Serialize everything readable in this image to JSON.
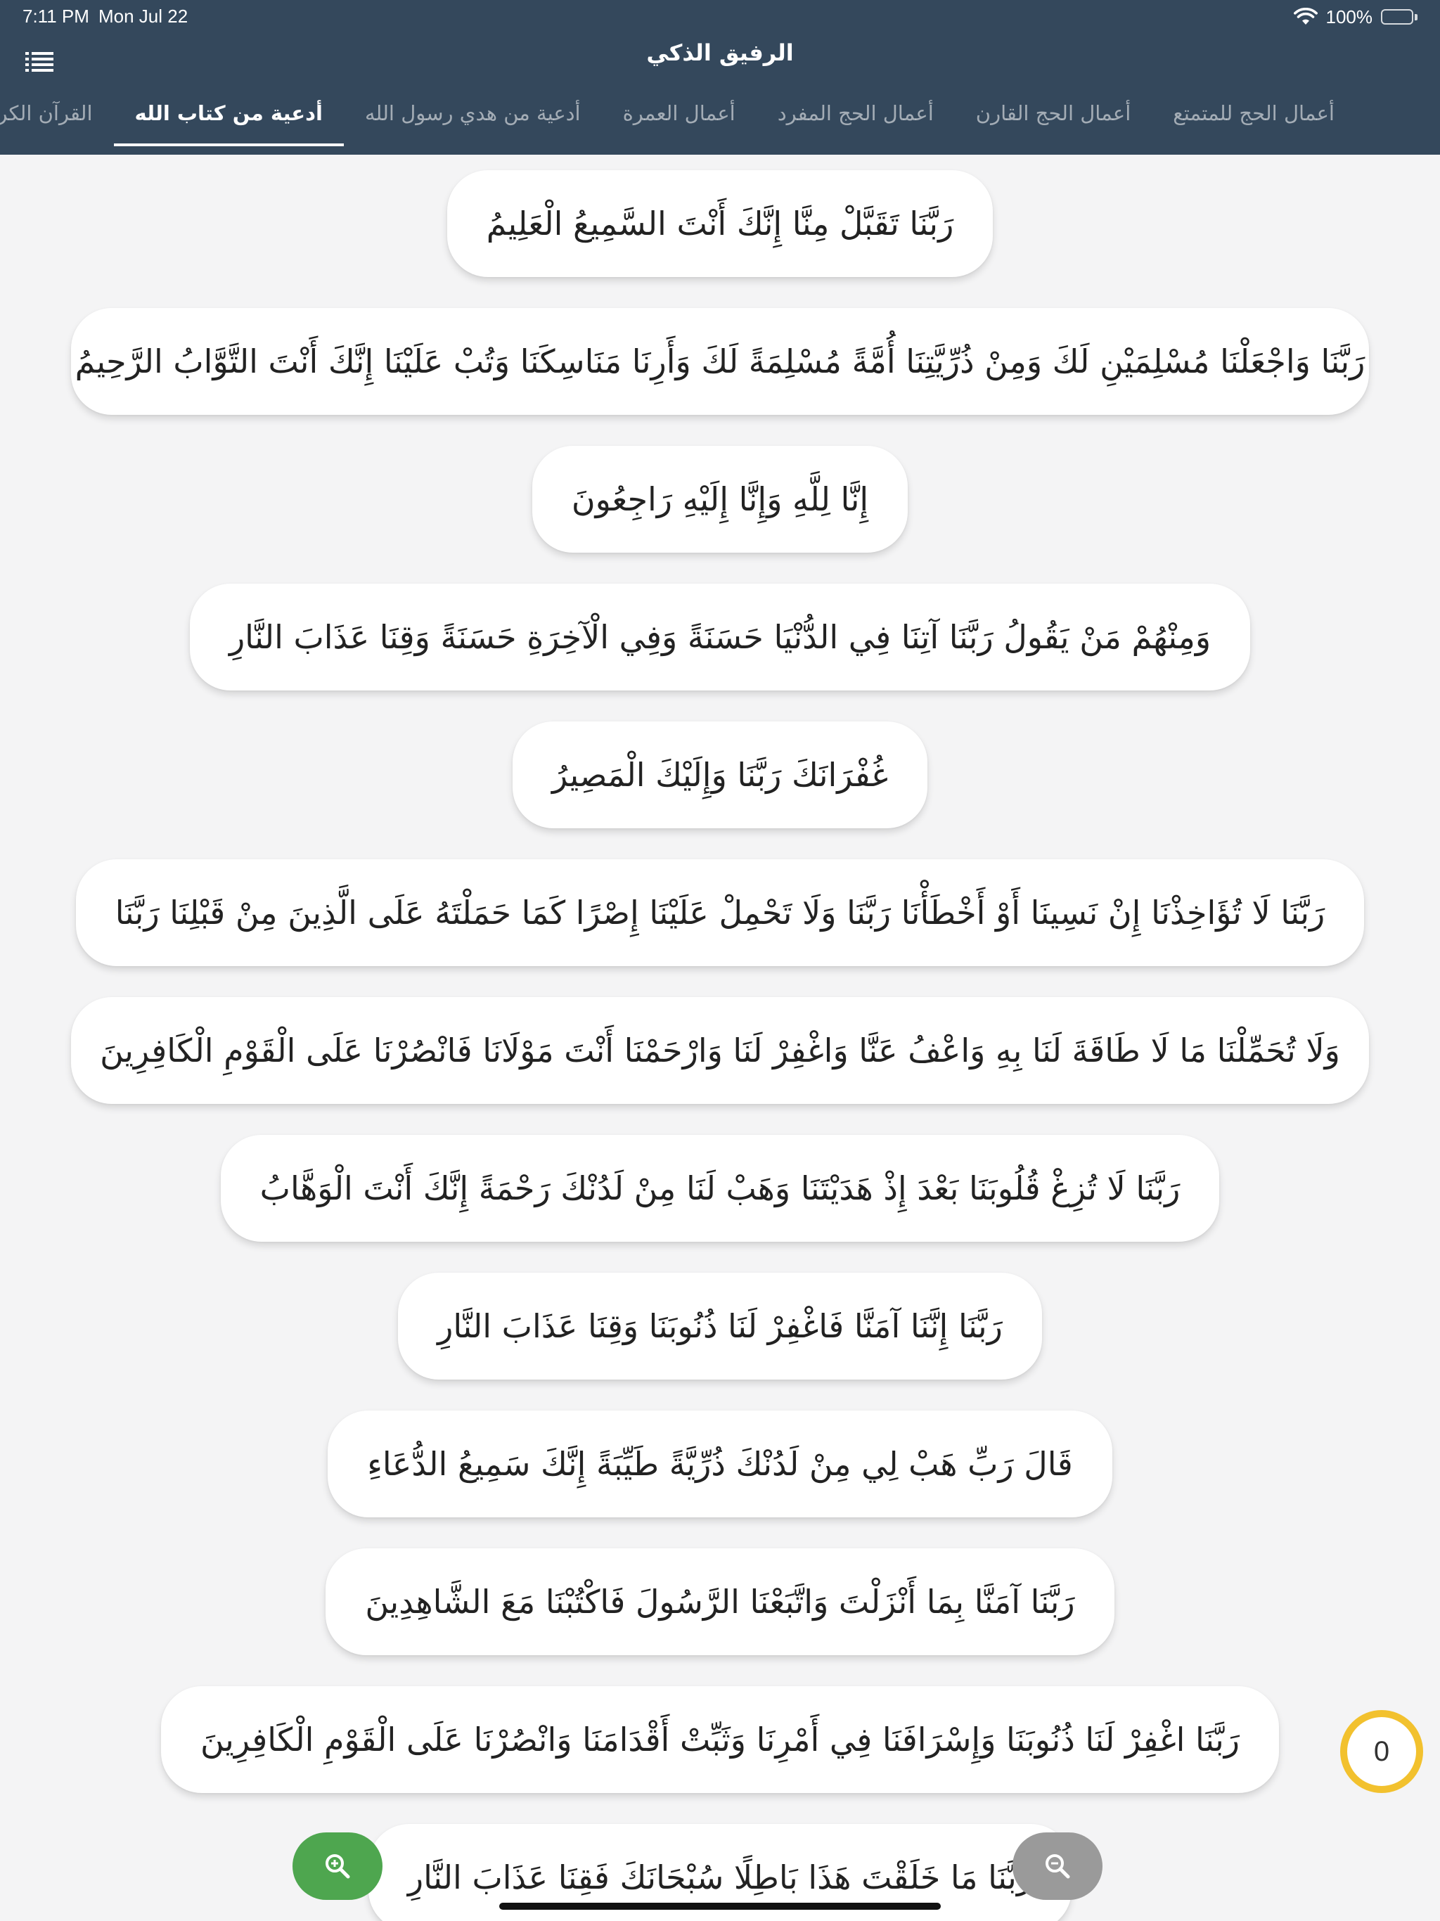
{
  "status_bar": {
    "time": "7:11 PM",
    "date": "Mon Jul 22",
    "battery": "100%"
  },
  "header": {
    "title": "الرفيق الذكي",
    "menu_icon": "menu-list-icon"
  },
  "tabs": [
    {
      "label": "أعمال الحج للمتمتع",
      "active": false
    },
    {
      "label": "أعمال الحج القارن",
      "active": false
    },
    {
      "label": "أعمال الحج المفرد",
      "active": false
    },
    {
      "label": "أعمال العمرة",
      "active": false
    },
    {
      "label": "أدعية من هدي رسول الله",
      "active": false
    },
    {
      "label": "أدعية من كتاب الله",
      "active": true
    },
    {
      "label": "القرآن الكريم",
      "active": false
    }
  ],
  "duas": [
    "رَبَّنَا تَقَبَّلْ مِنَّا إِنَّكَ أَنْتَ السَّمِيعُ الْعَلِيمُ",
    "رَبَّنَا وَاجْعَلْنَا مُسْلِمَيْنِ لَكَ وَمِنْ ذُرِّيَّتِنَا أُمَّةً مُسْلِمَةً لَكَ وَأَرِنَا مَنَاسِكَنَا وَتُبْ عَلَيْنَا إِنَّكَ أَنْتَ التَّوَّابُ الرَّحِيمُ",
    "إِنَّا لِلَّهِ وَإِنَّا إِلَيْهِ رَاجِعُونَ",
    "وَمِنْهُمْ مَنْ يَقُولُ رَبَّنَا آتِنَا فِي الدُّنْيَا حَسَنَةً وَفِي الْآخِرَةِ حَسَنَةً وَقِنَا عَذَابَ النَّارِ",
    "غُفْرَانَكَ رَبَّنَا وَإِلَيْكَ الْمَصِيرُ",
    "رَبَّنَا لَا تُؤَاخِذْنَا إِنْ نَسِينَا أَوْ أَخْطَأْنَا رَبَّنَا وَلَا تَحْمِلْ عَلَيْنَا إِصْرًا كَمَا حَمَلْتَهُ عَلَى الَّذِينَ مِنْ قَبْلِنَا رَبَّنَا",
    "وَلَا تُحَمِّلْنَا مَا لَا طَاقَةَ لَنَا بِهِ وَاعْفُ عَنَّا وَاغْفِرْ لَنَا وَارْحَمْنَا أَنْتَ مَوْلَانَا فَانْصُرْنَا عَلَى الْقَوْمِ الْكَافِرِينَ",
    "رَبَّنَا لَا تُزِغْ قُلُوبَنَا بَعْدَ إِذْ هَدَيْتَنَا وَهَبْ لَنَا مِنْ لَدُنْكَ رَحْمَةً إِنَّكَ أَنْتَ الْوَهَّابُ",
    "رَبَّنَا إِنَّنَا آمَنَّا فَاغْفِرْ لَنَا ذُنُوبَنَا وَقِنَا عَذَابَ النَّارِ",
    "قَالَ رَبِّ هَبْ لِي مِنْ لَدُنْكَ ذُرِّيَّةً طَيِّبَةً إِنَّكَ سَمِيعُ الدُّعَاءِ",
    "رَبَّنَا آمَنَّا بِمَا أَنْزَلْتَ وَاتَّبَعْنَا الرَّسُولَ فَاكْتُبْنَا مَعَ الشَّاهِدِينَ",
    "رَبَّنَا اغْفِرْ لَنَا ذُنُوبَنَا وَإِسْرَافَنَا فِي أَمْرِنَا وَثَبِّتْ أَقْدَامَنَا وَانْصُرْنَا عَلَى الْقَوْمِ الْكَافِرِينَ",
    "رَبَّنَا مَا خَلَقْتَ هَذَا بَاطِلًا سُبْحَانَكَ فَقِنَا عَذَابَ النَّارِ"
  ],
  "counter": {
    "value": "0"
  },
  "colors": {
    "header_bg": "#34485c",
    "page_bg": "#f4f4f5",
    "counter_ring": "#f2c12e",
    "zoom_in": "#4ea64f",
    "zoom_out": "#9a9a9a"
  },
  "icons": {
    "zoom_in": "zoom-in-icon",
    "zoom_out": "zoom-out-icon",
    "wifi": "wifi-icon",
    "battery": "battery-icon"
  }
}
